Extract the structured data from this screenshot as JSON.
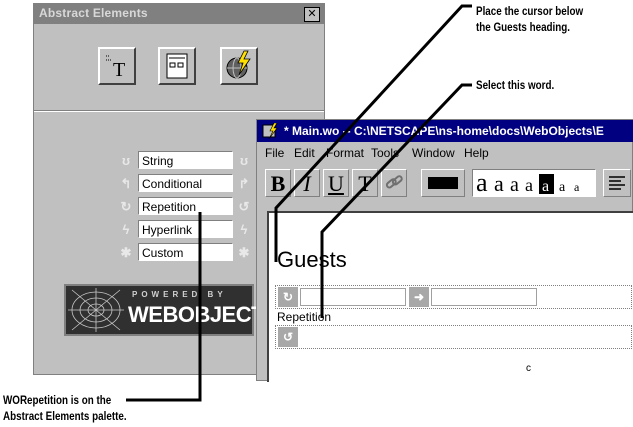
{
  "palette": {
    "title": "Abstract Elements",
    "close": "✕",
    "items": [
      {
        "label": "String"
      },
      {
        "label": "Conditional"
      },
      {
        "label": "Repetition"
      },
      {
        "label": "Hyperlink"
      },
      {
        "label": "Custom"
      }
    ],
    "logo": {
      "small": "POWERED BY",
      "big": "WEBOBJECTS"
    }
  },
  "netscape": {
    "title": "* Main.wo --  C:\\NETSCAPE\\ns-home\\docs\\WebObjects\\E",
    "menu": [
      "File",
      "Edit",
      "Format",
      "Tools",
      "Window",
      "Help"
    ],
    "toolbar": {
      "bold": "B",
      "italic": "I",
      "underline": "U",
      "teletype": "T",
      "font_sizes": "aaaaaaa"
    },
    "heading": "Guests",
    "repetition_label": "Repetition"
  },
  "callouts": {
    "cursor": "Place the cursor below\nthe Guests heading.",
    "select": "Select this word.",
    "palette": "WORepetition is on the\nAbstract Elements palette."
  }
}
